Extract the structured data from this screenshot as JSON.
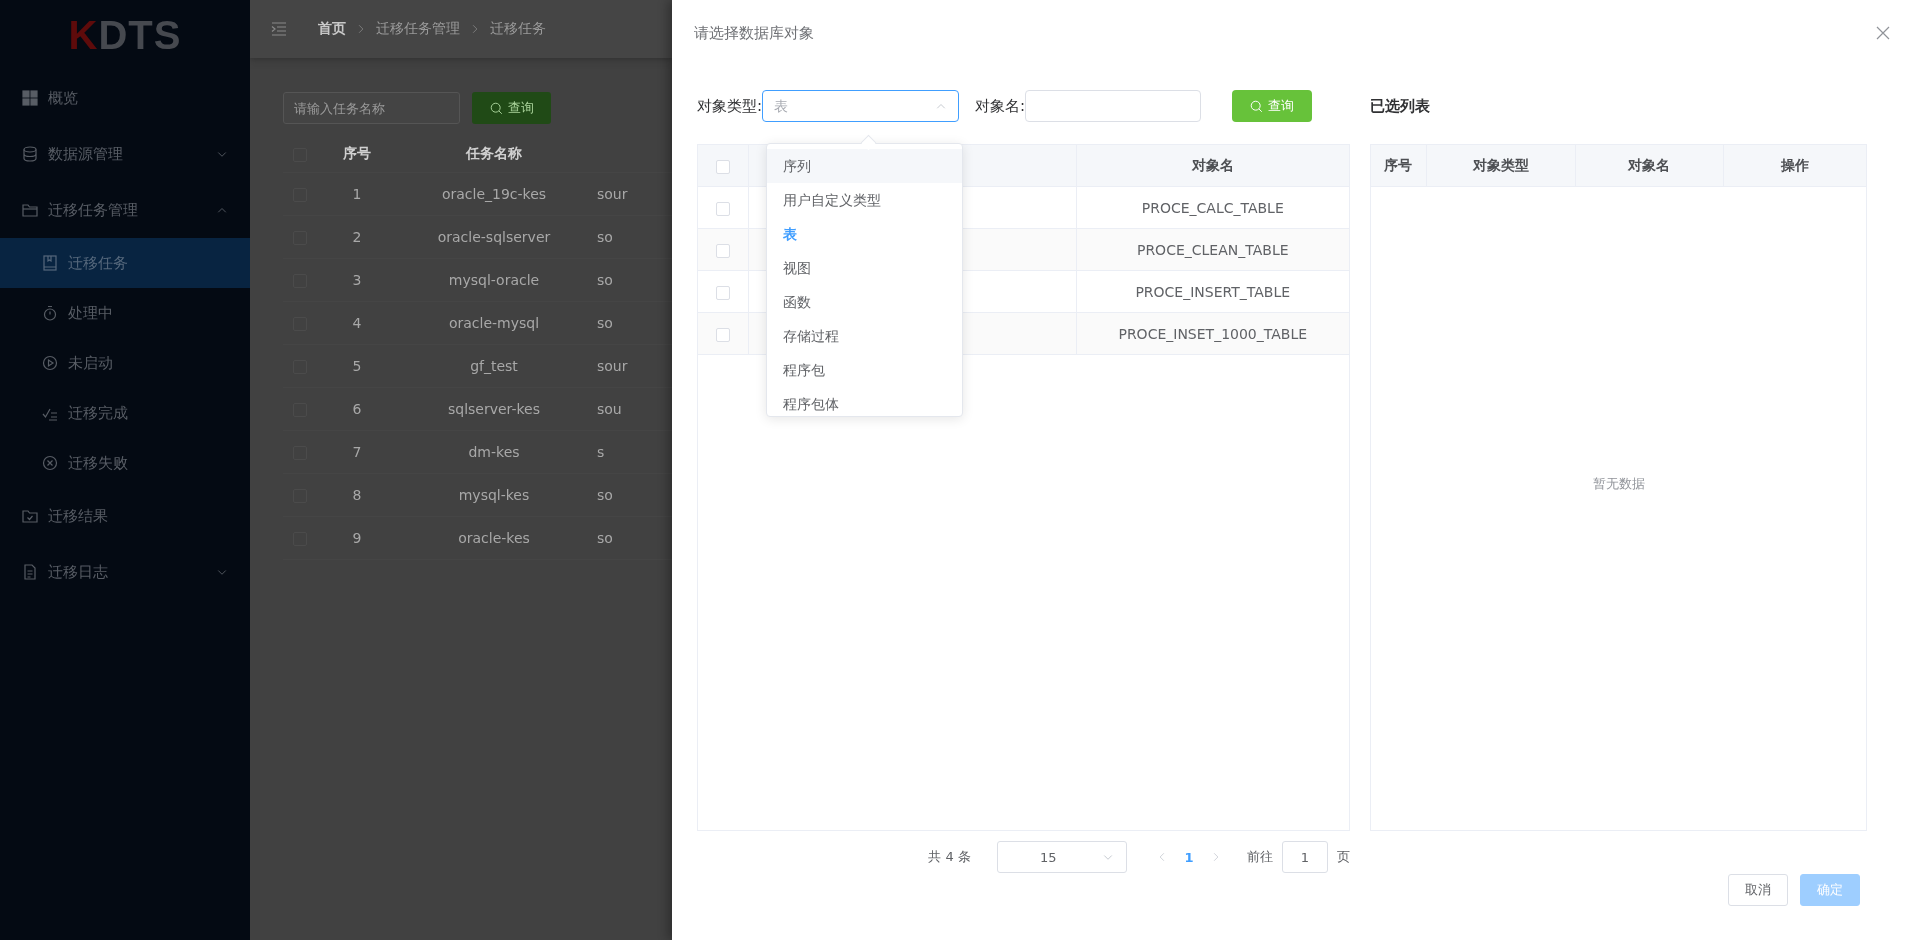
{
  "sidebar": {
    "logo": "KDTS",
    "items": [
      {
        "label": "概览",
        "kind": "item",
        "selected": false
      },
      {
        "label": "数据源管理",
        "kind": "submenu",
        "expanded": false,
        "selected": false
      },
      {
        "label": "迁移任务管理",
        "kind": "submenu",
        "expanded": true,
        "selected": false,
        "children": [
          {
            "label": "迁移任务",
            "selected": true
          },
          {
            "label": "处理中",
            "selected": false
          },
          {
            "label": "未启动",
            "selected": false
          },
          {
            "label": "迁移完成",
            "selected": false
          },
          {
            "label": "迁移失败",
            "selected": false
          }
        ]
      },
      {
        "label": "迁移结果",
        "kind": "item",
        "selected": false
      },
      {
        "label": "迁移日志",
        "kind": "submenu",
        "expanded": false,
        "selected": false
      }
    ]
  },
  "breadcrumb": [
    "首页",
    "迁移任务管理",
    "迁移任务"
  ],
  "task_search": {
    "placeholder": "请输入任务名称",
    "button": "查询"
  },
  "task_table": {
    "all_checked": false,
    "columns": [
      "序号",
      "任务名称"
    ],
    "rows": [
      {
        "checked": false,
        "index": "1",
        "name": "oracle_19c-kes",
        "column_3": "sour"
      },
      {
        "checked": false,
        "index": "2",
        "name": "oracle-sqlserver",
        "column_3": "so"
      },
      {
        "checked": false,
        "index": "3",
        "name": "mysql-oracle",
        "column_3": "so"
      },
      {
        "checked": false,
        "index": "4",
        "name": "oracle-mysql",
        "column_3": "so"
      },
      {
        "checked": false,
        "index": "5",
        "name": "gf_test",
        "column_3": "sour"
      },
      {
        "checked": false,
        "index": "6",
        "name": "sqlserver-kes",
        "column_3": "sou"
      },
      {
        "checked": false,
        "index": "7",
        "name": "dm-kes",
        "column_3": "s"
      },
      {
        "checked": false,
        "index": "8",
        "name": "mysql-kes",
        "column_3": "so"
      },
      {
        "checked": false,
        "index": "9",
        "name": "oracle-kes",
        "column_3": "so"
      }
    ]
  },
  "dialog": {
    "title": "请选择数据库对象",
    "type_label": "对象类型:",
    "type_placeholder": "表",
    "dropdown_open": true,
    "name_label": "对象名:",
    "query_button": "查询",
    "type_options": [
      {
        "label": "序列",
        "highlighted": true,
        "selected": false
      },
      {
        "label": "用户自定义类型",
        "highlighted": false,
        "selected": false
      },
      {
        "label": "表",
        "highlighted": false,
        "selected": true
      },
      {
        "label": "视图",
        "highlighted": false,
        "selected": false
      },
      {
        "label": "函数",
        "highlighted": false,
        "selected": false
      },
      {
        "label": "存储过程",
        "highlighted": false,
        "selected": false
      },
      {
        "label": "程序包",
        "highlighted": false,
        "selected": false
      },
      {
        "label": "程序包体",
        "highlighted": false,
        "selected": false
      }
    ],
    "object_table": {
      "all_checked": false,
      "name_column": "对象名",
      "rows": [
        {
          "checked": false,
          "name": "PROCE_CALC_TABLE"
        },
        {
          "checked": false,
          "name": "PROCE_CLEAN_TABLE"
        },
        {
          "checked": false,
          "name": "PROCE_INSERT_TABLE"
        },
        {
          "checked": false,
          "name": "PROCE_INSET_1000_TABLE"
        }
      ]
    },
    "selected_list": {
      "title": "已选列表",
      "columns": [
        "序号",
        "对象类型",
        "对象名",
        "操作"
      ],
      "empty_text": "暂无数据"
    },
    "pagination": {
      "total": "共 4 条",
      "page_size": "15",
      "pages": [
        {
          "label": "1",
          "selected": true
        }
      ],
      "goto_label": "前往",
      "goto_value": "1",
      "goto_suffix": "页"
    },
    "buttons": [
      {
        "label": "取消",
        "disabled": false
      },
      {
        "label": "确定",
        "disabled": true
      }
    ]
  }
}
